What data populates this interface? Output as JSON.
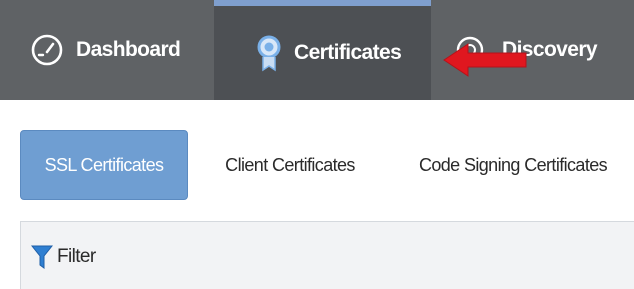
{
  "topnav": {
    "tabs": [
      {
        "label": "Dashboard",
        "icon": "gauge-icon"
      },
      {
        "label": "Certificates",
        "icon": "certificate-badge-icon",
        "active": true
      },
      {
        "label": "Discovery",
        "icon": "radar-icon"
      }
    ]
  },
  "annotation": {
    "arrow_color": "#e0171f",
    "icon": "red-arrow-icon"
  },
  "subtabs": [
    {
      "label": "SSL Certificates",
      "active": true
    },
    {
      "label": "Client Certificates"
    },
    {
      "label": "Code Signing Certificates"
    }
  ],
  "filter": {
    "label": "Filter",
    "icon": "filter-funnel-icon"
  },
  "colors": {
    "nav_bg": "#5f6265",
    "nav_active_bg": "#4d5054",
    "nav_active_accent": "#7f9fce",
    "subtab_active_bg": "#6f9ed2",
    "filter_bg": "#f2f3f5"
  }
}
